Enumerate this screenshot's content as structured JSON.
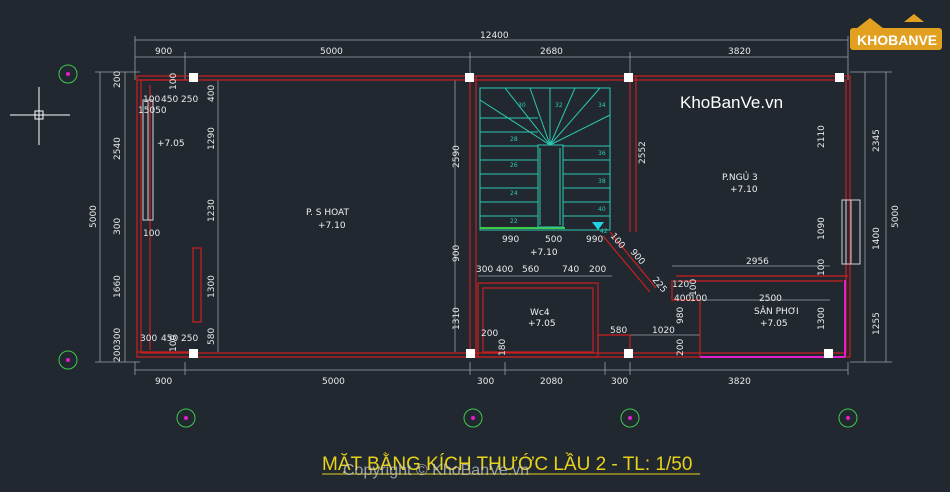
{
  "watermark": {
    "logo_text": "KHOBANVE",
    "site_text": "KhoBanVe.vn",
    "copyright_text": "Copyright © KhoBanVe.vn"
  },
  "title": "MẶT BẰNG KÍCH THƯỚC LẦU 2 - TL: 1/50",
  "colors": {
    "background": "#212830",
    "wall": "#cc1f1f",
    "dimension": "#9aa0a6",
    "stair": "#2bc9b0",
    "title": "#e8d21a",
    "magenta": "#e020c8"
  },
  "top_dims": {
    "overall": "12400",
    "seg1": "900",
    "seg2": "5000",
    "seg3": "2680",
    "seg4": "3820"
  },
  "bottom_dims": {
    "seg1": "900",
    "seg2": "5000",
    "seg3": "300",
    "seg4": "2080",
    "seg5": "300",
    "seg6": "3820"
  },
  "left_dims": {
    "overall": "5000",
    "d200": "200",
    "d2540": "2540",
    "d300": "300",
    "d1660": "1660",
    "d200b": "200",
    "d300b": "300"
  },
  "inner_left_dims": {
    "d400": "400",
    "d1290": "1290",
    "d1230": "1230",
    "d1300": "1300",
    "d580": "580",
    "d100": "100",
    "d100b": "100"
  },
  "balcony_dims": {
    "top_100": "100",
    "top_450": "450",
    "top_250": "250",
    "top_15050": "15050",
    "bot_300": "300",
    "bot_450": "450",
    "bot_250": "250",
    "mid_100": "100"
  },
  "right_dims": {
    "overall": "5000",
    "d2345": "2345",
    "d1400": "1400",
    "d1255": "1255",
    "d2110": "2110",
    "d1090": "1090",
    "d100": "100",
    "d1300": "1300"
  },
  "stair_dims": {
    "d2590": "2590",
    "d2552": "2552",
    "d990a": "990",
    "d500": "500",
    "d990b": "990",
    "d100": "100",
    "d900": "900",
    "d900b": "900",
    "d225": "225"
  },
  "wc_dims": {
    "d300": "300",
    "d400": "400",
    "d560": "560",
    "d740": "740",
    "d200": "200",
    "d1310": "1310",
    "d200b": "200",
    "d180": "180",
    "d580": "580",
    "d1020": "1020"
  },
  "yard_dims": {
    "d2956": "2956",
    "d120": "120",
    "d400": "400",
    "d100": "100",
    "d2500": "2500",
    "d980": "980",
    "d200": "200",
    "d100b": "100"
  },
  "stair_numbers": [
    "22",
    "24",
    "26",
    "28",
    "30",
    "32",
    "34",
    "36",
    "38",
    "40",
    "42"
  ],
  "rooms": [
    {
      "name": "P. S HOAT",
      "level": "+7.10"
    },
    {
      "name": "P.NGỦ 3",
      "level": "+7.10"
    },
    {
      "name": "Wc4",
      "level": "+7.05"
    },
    {
      "name": "SÂN PHƠI",
      "level": "+7.05"
    }
  ],
  "levels": {
    "balcony": "+7.05",
    "stair_landing": "+7.10"
  }
}
